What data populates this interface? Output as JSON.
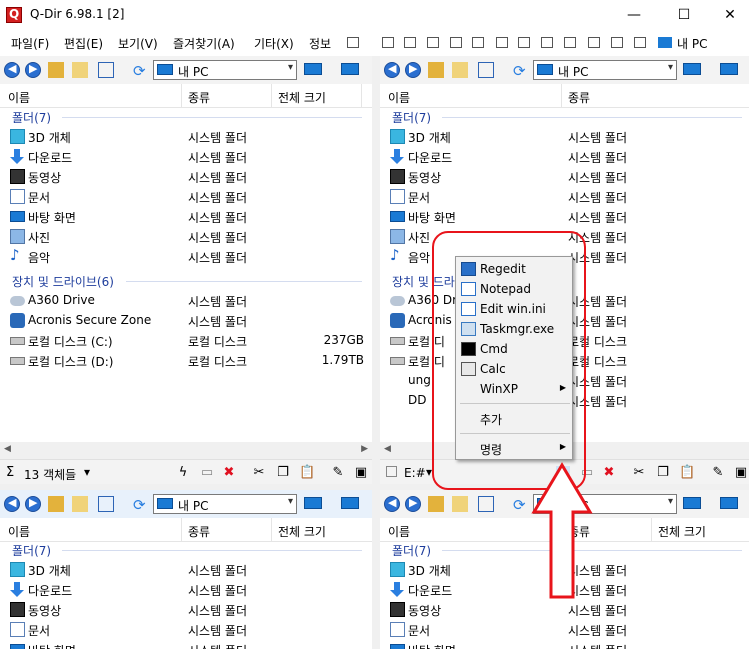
{
  "window": {
    "title": "Q-Dir 6.98.1 [2]",
    "minimize": "—",
    "maximize": "☐",
    "close": "✕"
  },
  "menu": {
    "items": [
      "파일(F)",
      "편집(E)",
      "보기(V)",
      "즐겨찾기(A)",
      "기타(X)",
      "정보"
    ],
    "right_label": "내 PC"
  },
  "columns": {
    "name": "이름",
    "type": "종류",
    "size": "전체 크기"
  },
  "address_text": "내 PC",
  "groups": {
    "folders": "폴더(7)",
    "drives": "장치 및 드라이브(6)"
  },
  "folders": [
    {
      "name": "3D 개체",
      "type": "시스템 폴더",
      "icon": "cube-3d-icon"
    },
    {
      "name": "다운로드",
      "type": "시스템 폴더",
      "icon": "download-icon"
    },
    {
      "name": "동영상",
      "type": "시스템 폴더",
      "icon": "video-icon"
    },
    {
      "name": "문서",
      "type": "시스템 폴더",
      "icon": "document-icon"
    },
    {
      "name": "바탕 화면",
      "type": "시스템 폴더",
      "icon": "desktop-icon"
    },
    {
      "name": "사진",
      "type": "시스템 폴더",
      "icon": "picture-icon"
    },
    {
      "name": "음악",
      "type": "시스템 폴더",
      "icon": "music-icon"
    }
  ],
  "drives": [
    {
      "name": "A360 Drive",
      "type": "시스템 폴더",
      "size": "",
      "icon": "cloud-drive-icon"
    },
    {
      "name": "Acronis Secure Zone",
      "type": "시스템 폴더",
      "size": "",
      "icon": "shield-drive-icon"
    },
    {
      "name": "로컬 디스크 (C:)",
      "type": "로컬 디스크",
      "size": "237GB",
      "icon": "disk-icon"
    },
    {
      "name": "로컬 디스크 (D:)",
      "type": "로컬 디스크",
      "size": "1.79TB",
      "icon": "disk-icon"
    }
  ],
  "tr_partial": {
    "drive_names": [
      "A360 Dri",
      "Acronis S",
      "로컬 디",
      "로컬 디"
    ],
    "extra_rows": [
      "ung",
      "DD"
    ],
    "extra_types": [
      "시스템 폴더",
      "시스템 폴더"
    ]
  },
  "status_left": {
    "count": "13 객체들",
    "dropdown": "▾"
  },
  "status_right": {
    "drive": "E:#",
    "dropdown": "▾"
  },
  "bottom_partial": {
    "desktop_name": "바탕 화면",
    "desktop_type": "시스템 폴더"
  },
  "context_menu": {
    "items": [
      {
        "label": "Regedit",
        "icon": "regedit-icon"
      },
      {
        "label": "Notepad",
        "icon": "notepad-icon"
      },
      {
        "label": "Edit win.ini",
        "icon": "edit-ini-icon"
      },
      {
        "label": "Taskmgr.exe",
        "icon": "taskmgr-icon"
      },
      {
        "label": "Cmd",
        "icon": "cmd-icon"
      },
      {
        "label": "Calc",
        "icon": "calc-icon"
      },
      {
        "label": "WinXP",
        "icon": "",
        "submenu": true
      }
    ],
    "add_label": "추가",
    "command_label": "명령"
  },
  "colors": {
    "highlight": "#e8141b",
    "group_text": "#1e3d9c"
  }
}
